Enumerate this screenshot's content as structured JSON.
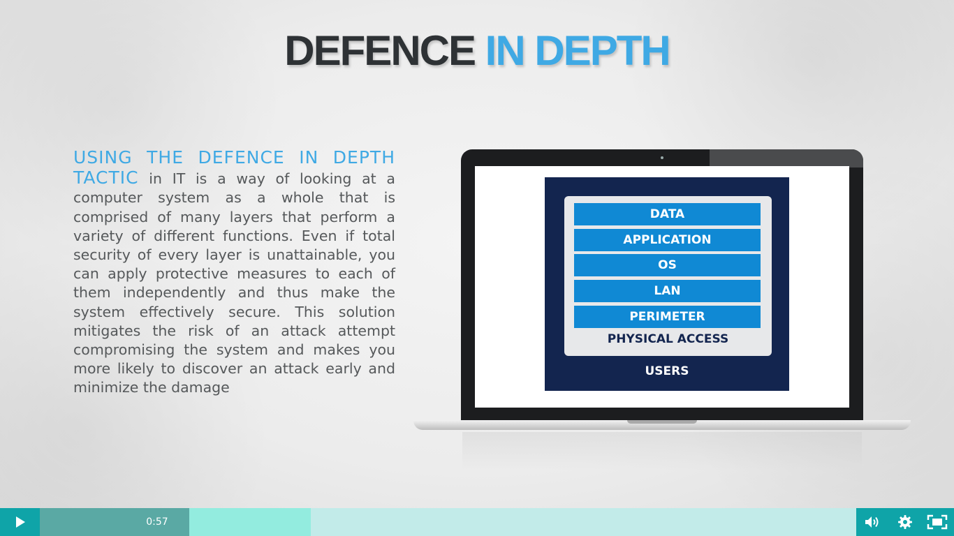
{
  "slide": {
    "title_part1": "DEFENCE",
    "title_part2": "IN DEPTH",
    "lead": "USING THE DEFENCE IN DEPTH TACTIC",
    "body": " in IT is a way of looking at a computer system as a whole that is comprised of many layers that perform a variety of different functions. Even if total security of every layer is unattainable, you can apply protective measures to each of them independently and thus make the system effectively secure. This solution mitigates the risk of an attack attempt compromising the system and makes you more likely to discover an attack early and minimize the damage"
  },
  "diagram": {
    "layers": [
      "DATA",
      "APPLICATION",
      "OS",
      "LAN",
      "PERIMETER"
    ],
    "physical": "PHYSICAL ACCESS",
    "outer": "USERS",
    "colors": {
      "navy": "#13254f",
      "layer_blue": "#1089d4",
      "inner": "#e7e8ea"
    }
  },
  "player": {
    "time": "0:57",
    "progress_played": 0.183,
    "progress_buffered": 0.332,
    "icons": [
      "play-icon",
      "volume-icon",
      "settings-icon",
      "fullscreen-icon"
    ],
    "colors": {
      "accent": "#0fa4a8",
      "track": "#c2ebe9",
      "played": "#5aa9a4",
      "buffered": "#93ecdf"
    }
  }
}
